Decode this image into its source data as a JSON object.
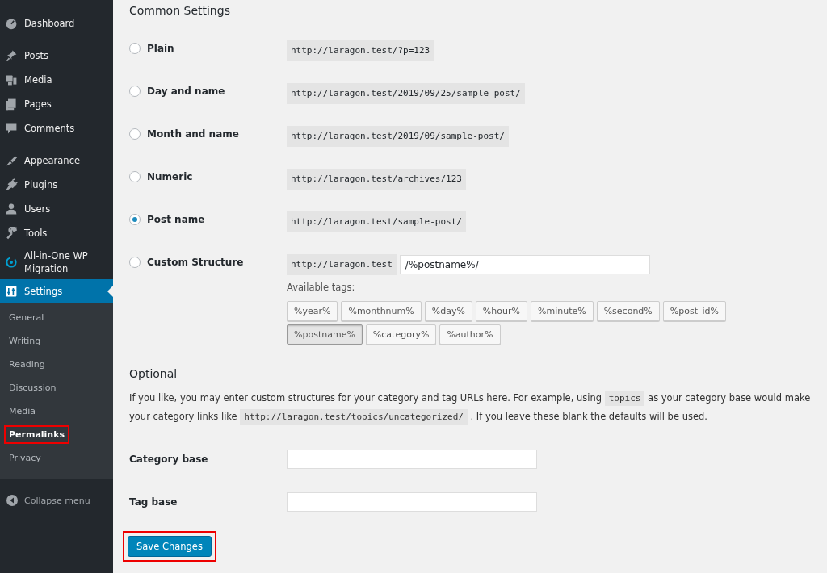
{
  "sidebar": {
    "groups": [
      [
        {
          "label": "Dashboard",
          "selected": false
        }
      ],
      [
        {
          "label": "Posts",
          "selected": false
        },
        {
          "label": "Media",
          "selected": false
        },
        {
          "label": "Pages",
          "selected": false
        },
        {
          "label": "Comments",
          "selected": false
        }
      ],
      [
        {
          "label": "Appearance",
          "selected": false
        },
        {
          "label": "Plugins",
          "selected": false
        },
        {
          "label": "Users",
          "selected": false
        },
        {
          "label": "Tools",
          "selected": false
        },
        {
          "label": "All-in-One WP Migration",
          "selected": false
        },
        {
          "label": "Settings",
          "selected": true
        }
      ]
    ],
    "submenu": [
      {
        "label": "General",
        "selected": false,
        "highlighted": false
      },
      {
        "label": "Writing",
        "selected": false,
        "highlighted": false
      },
      {
        "label": "Reading",
        "selected": false,
        "highlighted": false
      },
      {
        "label": "Discussion",
        "selected": false,
        "highlighted": false
      },
      {
        "label": "Media",
        "selected": false,
        "highlighted": false
      },
      {
        "label": "Permalinks",
        "selected": true,
        "highlighted": true
      },
      {
        "label": "Privacy",
        "selected": false,
        "highlighted": false
      }
    ],
    "collapse": "Collapse menu"
  },
  "common_settings": {
    "title": "Common Settings",
    "options": [
      {
        "kind": "example",
        "label": "Plain",
        "selected": false,
        "example": "http://laragon.test/?p=123"
      },
      {
        "kind": "example",
        "label": "Day and name",
        "selected": false,
        "example": "http://laragon.test/2019/09/25/sample-post/"
      },
      {
        "kind": "example",
        "label": "Month and name",
        "selected": false,
        "example": "http://laragon.test/2019/09/sample-post/"
      },
      {
        "kind": "example",
        "label": "Numeric",
        "selected": false,
        "example": "http://laragon.test/archives/123"
      },
      {
        "kind": "example",
        "label": "Post name",
        "selected": true,
        "example": "http://laragon.test/sample-post/"
      },
      {
        "kind": "custom",
        "label": "Custom Structure",
        "selected": false,
        "prefix": "http://laragon.test",
        "value": "/%postname%/"
      }
    ],
    "tags_label": "Available tags:",
    "tags": [
      {
        "label": "%year%",
        "selected": false
      },
      {
        "label": "%monthnum%",
        "selected": false
      },
      {
        "label": "%day%",
        "selected": false
      },
      {
        "label": "%hour%",
        "selected": false
      },
      {
        "label": "%minute%",
        "selected": false
      },
      {
        "label": "%second%",
        "selected": false
      },
      {
        "label": "%post_id%",
        "selected": false
      },
      {
        "label": "%postname%",
        "selected": true
      },
      {
        "label": "%category%",
        "selected": false
      },
      {
        "label": "%author%",
        "selected": false
      }
    ]
  },
  "optional": {
    "title": "Optional",
    "description": [
      {
        "kind": "text",
        "text": "If you like, you may enter custom structures for your category and tag URLs here. For example, using "
      },
      {
        "kind": "code",
        "text": "topics"
      },
      {
        "kind": "text",
        "text": " as your category base would make your category links like "
      },
      {
        "kind": "code",
        "text": "http://laragon.test/topics/uncategorized/"
      },
      {
        "kind": "text",
        "text": " . If you leave these blank the defaults will be used."
      }
    ],
    "fields": [
      {
        "label": "Category base"
      },
      {
        "label": "Tag base"
      }
    ]
  },
  "save_button": {
    "label": "Save Changes",
    "highlighted": true
  }
}
